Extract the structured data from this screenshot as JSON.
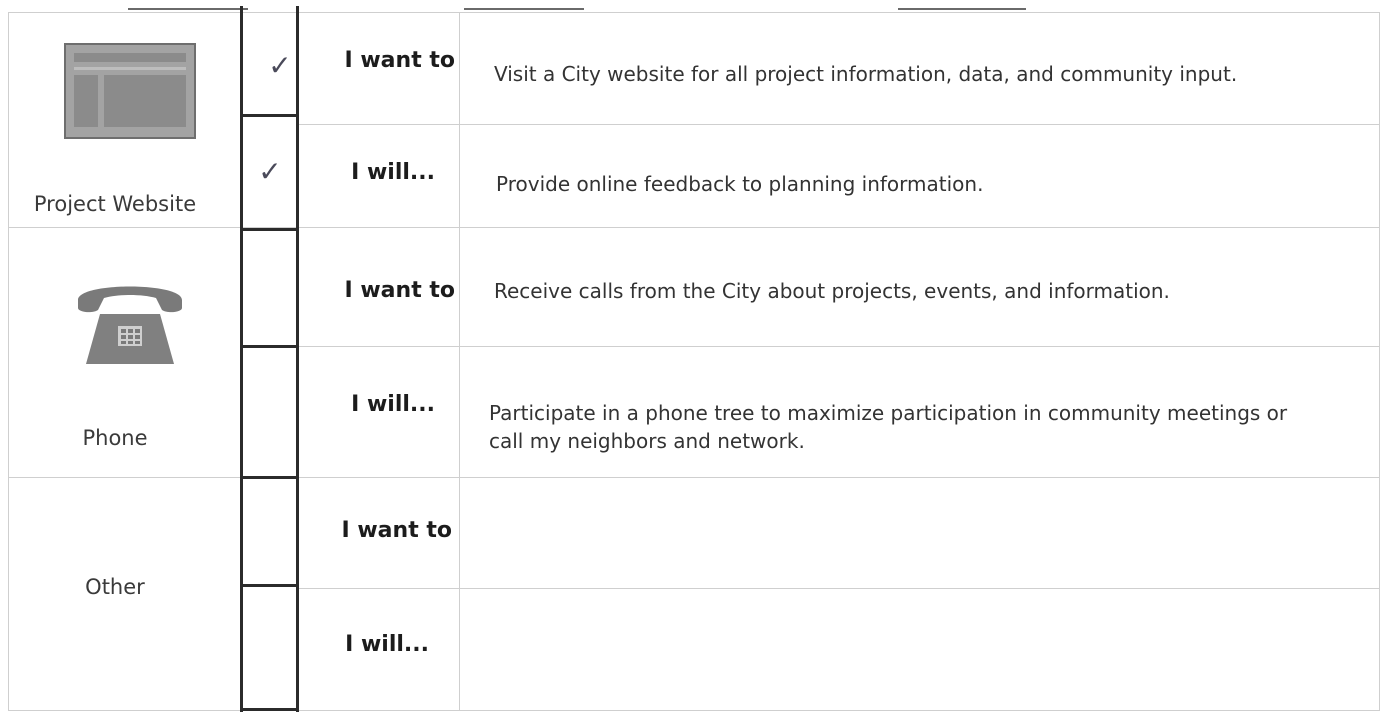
{
  "categories": [
    {
      "label": "Project Website",
      "icon": "website-icon"
    },
    {
      "label": "Phone",
      "icon": "phone-icon"
    },
    {
      "label": "Other",
      "icon": ""
    }
  ],
  "rows": [
    {
      "action": "I want to",
      "description": "Visit a City website for all project information, data, and community input.",
      "checked": true
    },
    {
      "action": "I will...",
      "description": "Provide online feedback to planning information.",
      "checked": true
    },
    {
      "action": "I want to",
      "description": "Receive calls from the City about projects, events, and information.",
      "checked": false
    },
    {
      "action": "I will...",
      "description": "Participate in a phone tree to maximize participation in community meetings or call my neighbors and network.",
      "checked": false
    },
    {
      "action": "I want to",
      "description": "",
      "checked": false
    },
    {
      "action": "I will...",
      "description": "",
      "checked": false
    }
  ],
  "check_glyph": "✓",
  "colors": {
    "icon_gray": "#8f8f8f",
    "icon_border": "#6e6e6e",
    "text": "#333333"
  }
}
